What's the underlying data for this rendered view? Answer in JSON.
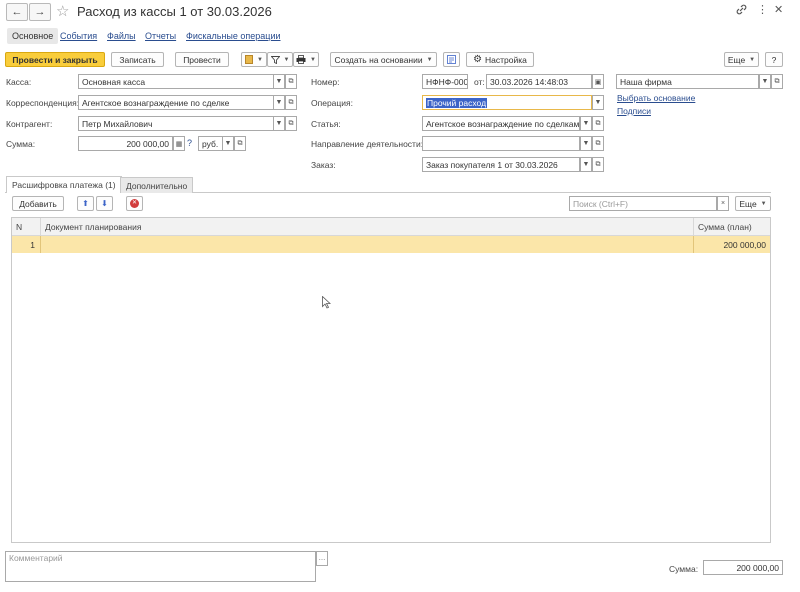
{
  "window": {
    "title": "Расход из кассы 1 от 30.03.2026",
    "back_icon": "←",
    "forward_icon": "→",
    "star_icon": "☆",
    "link_icon": "🔗",
    "more_icon": "⋮",
    "close_icon": "✕"
  },
  "sections": {
    "main": "Основное",
    "events": "События",
    "files": "Файлы",
    "reports": "Отчеты",
    "fiscal": "Фискальные операции"
  },
  "toolbar": {
    "post_close": "Провести и закрыть",
    "save": "Записать",
    "post": "Провести",
    "create_based": "Создать на основании",
    "settings": "Настройка",
    "more": "Еще",
    "help": "?"
  },
  "form": {
    "kassa_label": "Касса:",
    "kassa_value": "Основная касса",
    "corr_label": "Корреспонденция:",
    "corr_value": "Агентское вознаграждение по сделке",
    "contractor_label": "Контрагент:",
    "contractor_value": "Петр Михайлович",
    "sum_label": "Сумма:",
    "sum_value": "200 000,00",
    "question": "?",
    "currency": "руб.",
    "number_label": "Номер:",
    "number_value": "НФНФ-000",
    "date_from_label": "от:",
    "date_value": "30.03.2026 14:48:03",
    "operation_label": "Операция:",
    "operation_value": "Прочий расход",
    "article_label": "Статья:",
    "article_value": "Агентское вознаграждение по сделкам",
    "direction_label": "Направление деятельности:",
    "direction_value": "",
    "order_label": "Заказ:",
    "order_value": "Заказ покупателя 1 от 30.03.2026",
    "org_value": "Наша фирма",
    "choose_basis": "Выбрать основание",
    "signatures": "Подписи"
  },
  "tabs": {
    "breakdown": "Расшифровка платежа (1)",
    "additional": "Дополнительно"
  },
  "table_toolbar": {
    "add": "Добавить",
    "search_placeholder": "Поиск (Ctrl+F)",
    "more": "Еще"
  },
  "table": {
    "columns": [
      "N",
      "Документ планирования",
      "Сумма (план)"
    ],
    "rows": [
      {
        "n": "1",
        "doc": "",
        "sum": "200 000,00"
      }
    ]
  },
  "footer": {
    "comment_placeholder": "Комментарий",
    "sum_label": "Сумма:",
    "sum_value": "200 000,00"
  },
  "colors": {
    "primary_button": "#f9cd3b",
    "selected_row": "#fbe6a9",
    "link": "#2a4d8f",
    "selection": "#3c64c8"
  }
}
